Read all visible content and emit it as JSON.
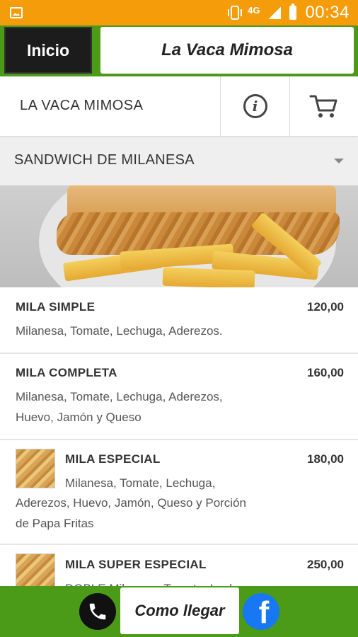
{
  "status_bar": {
    "network": "4G",
    "time": "00:34"
  },
  "header": {
    "inicio_label": "Inicio",
    "title": "La Vaca Mimosa"
  },
  "restaurant_bar": {
    "name": "LA VACA MIMOSA"
  },
  "category": {
    "label": "SANDWICH DE MILANESA"
  },
  "items": [
    {
      "name": "MILA SIMPLE",
      "price": "120,00",
      "desc_lines": [
        "Milanesa, Tomate, Lechuga, Aderezos."
      ]
    },
    {
      "name": "MILA COMPLETA",
      "price": "160,00",
      "desc_lines": [
        "Milanesa, Tomate, Lechuga, Aderezos,",
        "Huevo, Jamón y Queso"
      ]
    },
    {
      "name": "MILA ESPECIAL",
      "price": "180,00",
      "desc_lines": [
        "Milanesa, Tomate, Lechuga,",
        "Aderezos, Huevo, Jamón, Queso y Porción",
        "de Papa Fritas"
      ]
    },
    {
      "name": "MILA SUPER ESPECIAL",
      "price": "250,00",
      "desc_lines": [
        "DOBLE Milanesa, Tomate, Lechuga,"
      ]
    }
  ],
  "bottom_bar": {
    "directions_label": "Como llegar",
    "facebook_glyph": "f"
  },
  "colors": {
    "status_bar": "#f59c0a",
    "header_green": "#4b9b19",
    "facebook_blue": "#1877f2"
  }
}
